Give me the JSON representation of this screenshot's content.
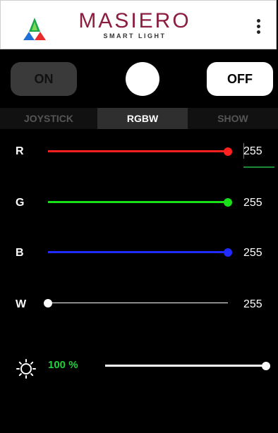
{
  "header": {
    "brand_title": "MASIERO",
    "brand_subtitle": "SMART LIGHT",
    "logo_icon": "rgb-pyramid-logo-icon",
    "menu_icon": "kebab-menu-icon"
  },
  "power": {
    "on_label": "ON",
    "off_label": "OFF",
    "indicator_color": "#ffffff"
  },
  "tabs": [
    {
      "label": "JOYSTICK",
      "active": false
    },
    {
      "label": "RGBW",
      "active": true
    },
    {
      "label": "SHOW",
      "active": false
    }
  ],
  "channels": [
    {
      "label": "R",
      "value": "255",
      "level": 1.0,
      "color": "#ff2020"
    },
    {
      "label": "G",
      "value": "255",
      "level": 1.0,
      "color": "#19e019"
    },
    {
      "label": "B",
      "value": "255",
      "level": 1.0,
      "color": "#1f2bff"
    },
    {
      "label": "W",
      "value": "255",
      "level": 0.0,
      "color": "#ffffff"
    }
  ],
  "brightness": {
    "icon": "sun-icon",
    "text": "100 %",
    "percent": 100,
    "text_color": "#1fd13c"
  }
}
